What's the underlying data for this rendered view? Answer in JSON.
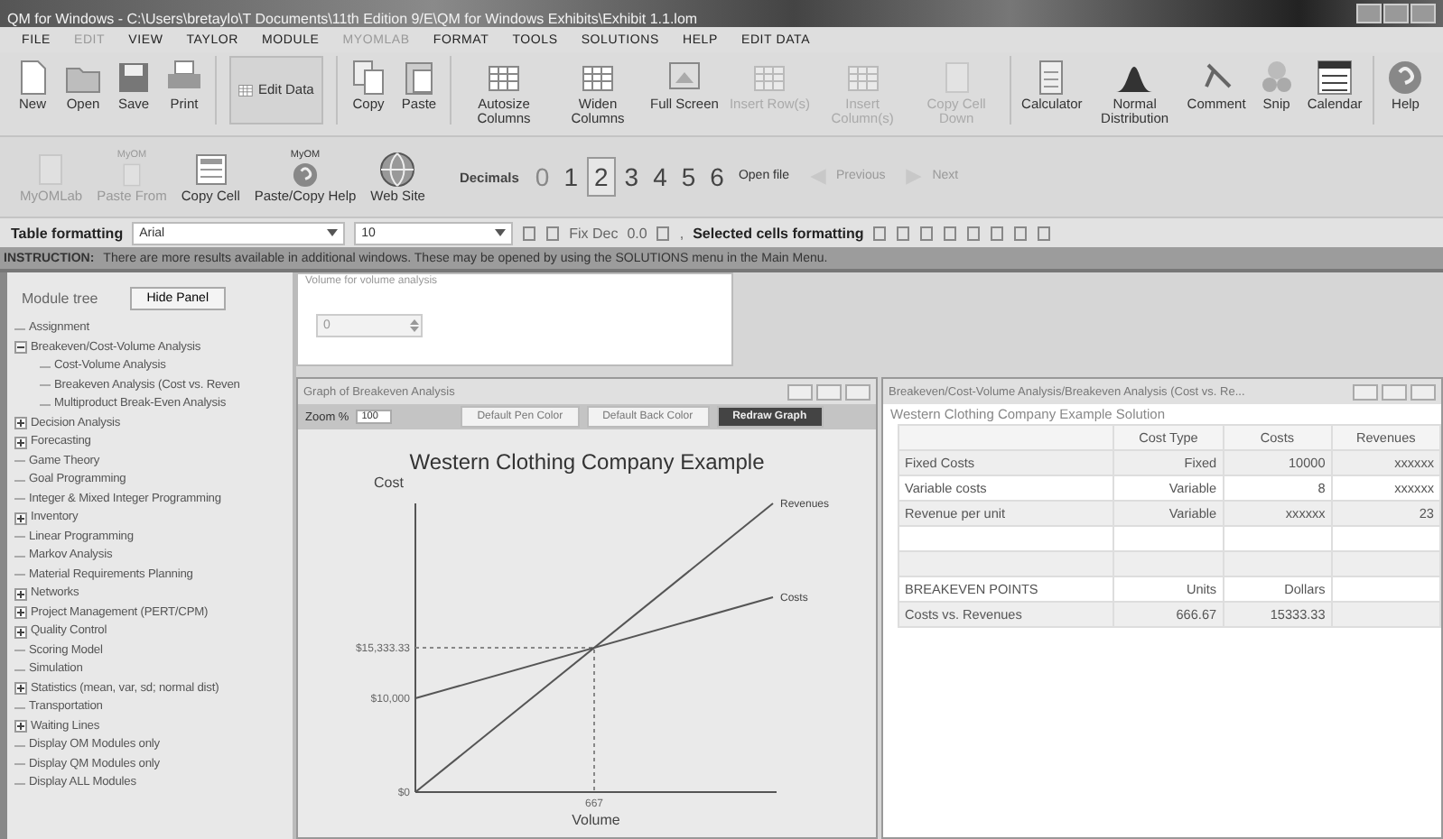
{
  "window": {
    "title": "QM for Windows - C:\\Users\\bretaylo\\T Documents\\11th Edition 9/E\\QM for Windows Exhibits\\Exhibit 1.1.lom"
  },
  "menu": [
    {
      "label": "FILE",
      "disabled": false
    },
    {
      "label": "EDIT",
      "disabled": true
    },
    {
      "label": "VIEW",
      "disabled": false
    },
    {
      "label": "TAYLOR",
      "disabled": false
    },
    {
      "label": "MODULE",
      "disabled": false
    },
    {
      "label": "MYOMLAB",
      "disabled": true
    },
    {
      "label": "FORMAT",
      "disabled": false
    },
    {
      "label": "TOOLS",
      "disabled": false
    },
    {
      "label": "SOLUTIONS",
      "disabled": false
    },
    {
      "label": "HELP",
      "disabled": false
    },
    {
      "label": "EDIT DATA",
      "disabled": false
    }
  ],
  "toolbar": [
    {
      "label": "New",
      "disabled": false
    },
    {
      "label": "Open",
      "disabled": false
    },
    {
      "label": "Save",
      "disabled": false
    },
    {
      "label": "Print",
      "disabled": false
    },
    {
      "label": "Edit Data",
      "disabled": false
    },
    {
      "label": "Copy",
      "disabled": false
    },
    {
      "label": "Paste",
      "disabled": false
    },
    {
      "label": "Autosize Columns",
      "disabled": false
    },
    {
      "label": "Widen Columns",
      "disabled": false
    },
    {
      "label": "Full Screen",
      "disabled": false
    },
    {
      "label": "Insert Row(s)",
      "disabled": true
    },
    {
      "label": "Insert Column(s)",
      "disabled": true
    },
    {
      "label": "Copy Cell Down",
      "disabled": true
    },
    {
      "label": "Calculator",
      "disabled": false
    },
    {
      "label": "Normal Distribution",
      "disabled": false
    },
    {
      "label": "Comment",
      "disabled": false
    },
    {
      "label": "Snip",
      "disabled": false
    },
    {
      "label": "Calendar",
      "disabled": false
    },
    {
      "label": "Help",
      "disabled": false
    }
  ],
  "toolbar2": {
    "items": [
      {
        "label": "MyOMLab",
        "disabled": true
      },
      {
        "label": "Paste From",
        "caption": "MyOM",
        "disabled": true
      },
      {
        "label": "Copy Cell",
        "disabled": false
      },
      {
        "label": "Paste/Copy Help",
        "caption": "MyOM",
        "disabled": false
      },
      {
        "label": "Web Site",
        "disabled": false
      }
    ],
    "decimals_label": "Decimals",
    "decimals": [
      {
        "label": "0",
        "selected": false,
        "disabled": true
      },
      {
        "label": "1",
        "selected": false,
        "disabled": false
      },
      {
        "label": "2",
        "selected": true,
        "disabled": false
      },
      {
        "label": "3",
        "selected": false,
        "disabled": false
      },
      {
        "label": "4",
        "selected": false,
        "disabled": false
      },
      {
        "label": "5",
        "selected": false,
        "disabled": false
      },
      {
        "label": "6",
        "selected": false,
        "disabled": false
      }
    ],
    "nav": [
      {
        "label": "Open file",
        "disabled": false
      },
      {
        "label": "Previous",
        "disabled": true
      },
      {
        "label": "Next",
        "disabled": true
      }
    ]
  },
  "format_bar": {
    "label": "Table formatting",
    "font": "Arial",
    "size": "10",
    "fix_dec": "Fix Dec",
    "dec_sample": "0.0",
    "comma": ",",
    "selected_label": "Selected cells formatting"
  },
  "instruction": {
    "label": "INSTRUCTION:",
    "text": "There are more results available in additional windows. These may be opened by using the SOLUTIONS menu in the Main Menu."
  },
  "module_tree": {
    "title": "Module tree",
    "hide_button": "Hide Panel",
    "items": [
      {
        "label": "Assignment",
        "kind": "leaf"
      },
      {
        "label": "Breakeven/Cost-Volume Analysis",
        "kind": "group",
        "expanded": true,
        "children": [
          {
            "label": "Cost-Volume Analysis",
            "kind": "leaf"
          },
          {
            "label": "Breakeven Analysis (Cost vs. Reven",
            "kind": "leaf"
          },
          {
            "label": "Multiproduct Break-Even Analysis",
            "kind": "leaf"
          }
        ]
      },
      {
        "label": "Decision Analysis",
        "kind": "group",
        "expanded": false
      },
      {
        "label": "Forecasting",
        "kind": "group",
        "expanded": false
      },
      {
        "label": "Game Theory",
        "kind": "leaf"
      },
      {
        "label": "Goal Programming",
        "kind": "leaf"
      },
      {
        "label": "Integer & Mixed Integer Programming",
        "kind": "leaf"
      },
      {
        "label": "Inventory",
        "kind": "group",
        "expanded": false
      },
      {
        "label": "Linear Programming",
        "kind": "leaf"
      },
      {
        "label": "Markov Analysis",
        "kind": "leaf"
      },
      {
        "label": "Material Requirements Planning",
        "kind": "leaf"
      },
      {
        "label": "Networks",
        "kind": "group",
        "expanded": false
      },
      {
        "label": "Project Management (PERT/CPM)",
        "kind": "group",
        "expanded": false
      },
      {
        "label": "Quality Control",
        "kind": "group",
        "expanded": false
      },
      {
        "label": "Scoring Model",
        "kind": "leaf"
      },
      {
        "label": "Simulation",
        "kind": "leaf"
      },
      {
        "label": "Statistics (mean, var, sd; normal dist)",
        "kind": "group",
        "expanded": false
      },
      {
        "label": "Transportation",
        "kind": "leaf"
      },
      {
        "label": "Waiting Lines",
        "kind": "group",
        "expanded": false
      },
      {
        "label": "Display OM Modules only",
        "kind": "leaf"
      },
      {
        "label": "Display QM Modules only",
        "kind": "leaf"
      },
      {
        "label": "Display ALL Modules",
        "kind": "leaf"
      }
    ]
  },
  "volume_panel": {
    "label": "Volume for volume analysis",
    "value": "0"
  },
  "graph_window": {
    "title": "Graph of Breakeven Analysis",
    "breakeven_volume": "667",
    "zoom_label": "Zoom %",
    "zoom": "100",
    "buttons": [
      "Default Pen Color",
      "Default Back Color",
      "Redraw Graph"
    ],
    "graph": {
      "title": "Western Clothing Company Example",
      "x_title": "Volume",
      "y_title": "Cost",
      "y_labels": [
        "$15,333.33",
        "$10,000",
        "$0"
      ],
      "line_labels": [
        "Revenues",
        "Costs"
      ]
    }
  },
  "solution_window": {
    "title": "Breakeven/Cost-Volume Analysis/Breakeven Analysis (Cost vs. Re...",
    "subtitle": "Western Clothing Company Example Solution",
    "columns": [
      "",
      "Cost Type",
      "Costs",
      "Revenues"
    ],
    "rows": [
      {
        "kind": "data",
        "cells": [
          "Fixed Costs",
          "Fixed",
          "10000",
          "xxxxxx"
        ]
      },
      {
        "kind": "data",
        "cells": [
          "Variable costs",
          "Variable",
          "8",
          "xxxxxx"
        ]
      },
      {
        "kind": "data",
        "cells": [
          "Revenue per unit",
          "Variable",
          "xxxxxx",
          "23"
        ]
      },
      {
        "kind": "blank",
        "cells": []
      },
      {
        "kind": "blank",
        "cells": []
      },
      {
        "kind": "data",
        "cells": [
          "BREAKEVEN POINTS",
          "Units",
          "Dollars"
        ]
      },
      {
        "kind": "data",
        "cells": [
          "Costs vs. Revenues",
          "666.67",
          "15333.33"
        ]
      }
    ]
  }
}
